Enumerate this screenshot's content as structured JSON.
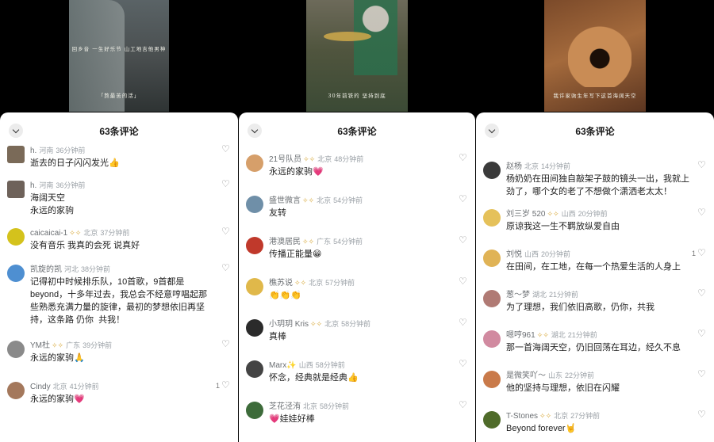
{
  "panels": [
    {
      "video": {
        "caption_top": "回乡音 一生好乐节 山工地吉他男神",
        "caption_bottom": "「熬最苦的活」"
      },
      "header": {
        "title": "63条评论"
      },
      "comments": [
        {
          "name": "h.",
          "badge": "",
          "location": "河南",
          "time": "36分钟前",
          "text": "逝去的日子闪闪发光👍",
          "likes": "",
          "avatar_color": "#7a6a58"
        },
        {
          "name": "h.",
          "badge": "",
          "location": "河南",
          "time": "36分钟前",
          "text": "海阔天空\n永远的家驹",
          "likes": "",
          "avatar_color": "#6e625a"
        },
        {
          "name": "caicaicai-1",
          "badge": "✧✧",
          "location": "北京",
          "time": "37分钟前",
          "text": "没有音乐 我真的会死 说真好",
          "likes": "",
          "avatar_color": "#d4c21c"
        },
        {
          "name": "凯旋的凯",
          "badge": "",
          "location": "河北",
          "time": "38分钟前",
          "text": "记得初中时候排乐队，10首歌，9首都是beyond，十多年过去，我总会不经意哼唱起那些熟悉充满力量的旋律，最初的梦想依旧再坚持，这条路 仍你  共我！",
          "likes": "",
          "avatar_color": "#4e8fd1"
        },
        {
          "name": "YM杜",
          "badge": "✧✧",
          "location": "广东",
          "time": "39分钟前",
          "text": "永远的家驹🙏",
          "likes": "",
          "avatar_color": "#8a8a8a"
        },
        {
          "name": "Cindy",
          "badge": "",
          "location": "北京",
          "time": "41分钟前",
          "text": "永远的家驹💗",
          "likes": "1",
          "avatar_color": "#a4785c"
        }
      ]
    },
    {
      "video": {
        "caption_top": "",
        "caption_bottom": "30年前铁的 坚持到底"
      },
      "header": {
        "title": "63条评论"
      },
      "comments": [
        {
          "name": "21号队员",
          "badge": "✧✧",
          "location": "北京",
          "time": "48分钟前",
          "text": "永远的家驹💗",
          "likes": "",
          "avatar_color": "#d69f6a"
        },
        {
          "name": "盛世微言",
          "badge": "✧✧",
          "location": "北京",
          "time": "54分钟前",
          "text": "友转",
          "likes": "",
          "avatar_color": "#6f8fa8"
        },
        {
          "name": "港澳居民",
          "badge": "✧✧",
          "location": "广东",
          "time": "54分钟前",
          "text": "传播正能量😁",
          "likes": "",
          "avatar_color": "#c0392b"
        },
        {
          "name": "樵苏说",
          "badge": "✧✧",
          "location": "北京",
          "time": "57分钟前",
          "text": "👏👏👏",
          "likes": "",
          "avatar_color": "#e0b84a"
        },
        {
          "name": "小玥玥 Kris",
          "badge": "✧✧",
          "location": "北京",
          "time": "58分钟前",
          "text": "真棒",
          "likes": "",
          "avatar_color": "#2b2b2b"
        },
        {
          "name": "Marx✨",
          "badge": "",
          "location": "山西",
          "time": "58分钟前",
          "text": "怀念，经典就是经典👍",
          "likes": "",
          "avatar_color": "#444"
        },
        {
          "name": "芝花泾洧",
          "badge": "",
          "location": "北京",
          "time": "58分钟前",
          "text": "💗娃娃好棒",
          "likes": "",
          "avatar_color": "#3d6b3a"
        }
      ]
    },
    {
      "video": {
        "caption_top": "",
        "caption_bottom": "我许家驹生年写下这首海阔天空"
      },
      "header": {
        "title": "63条评论"
      },
      "comments": [
        {
          "name": "赵杨",
          "badge": "",
          "location": "北京",
          "time": "14分钟前",
          "text": "杨奶奶在田间独自敲架子鼓的镜头一出，我就上劲了，哪个女的老了不想做个潇洒老太太！",
          "likes": "",
          "avatar_color": "#3a3a3a"
        },
        {
          "name": "刘三岁 520",
          "badge": "✧✧",
          "location": "山西",
          "time": "20分钟前",
          "text": "原谅我这一生不羁放纵爱自由",
          "likes": "",
          "avatar_color": "#e5c15a"
        },
        {
          "name": "刘悦",
          "badge": "",
          "location": "山西",
          "time": "20分钟前",
          "text": "在田间，在工地，在每一个热爱生活的人身上",
          "likes": "1",
          "avatar_color": "#e0b356"
        },
        {
          "name": "葱～梦",
          "badge": "",
          "location": "湖北",
          "time": "21分钟前",
          "text": "为了理想，我们依旧高歌，仍你，共我",
          "likes": "",
          "avatar_color": "#b07a74"
        },
        {
          "name": "嗯哼961",
          "badge": "✧✧",
          "location": "湖北",
          "time": "21分钟前",
          "text": "那一首海阔天空，仍旧回荡在耳边，经久不息",
          "likes": "",
          "avatar_color": "#d18aa0"
        },
        {
          "name": "是微笑吖～",
          "badge": "",
          "location": "山东",
          "time": "22分钟前",
          "text": "他的坚持与理想，依旧在闪耀",
          "likes": "",
          "avatar_color": "#c97a4a"
        },
        {
          "name": "T-Stones",
          "badge": "✧✧",
          "location": "北京",
          "time": "27分钟前",
          "text": "Beyond forever🤘",
          "likes": "",
          "avatar_color": "#4f6b2a"
        }
      ]
    }
  ]
}
